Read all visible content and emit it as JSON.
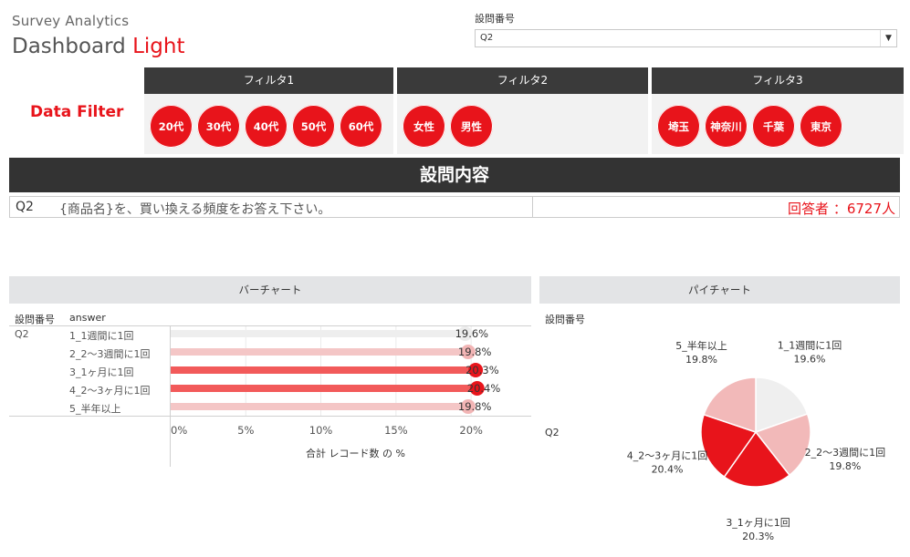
{
  "brand": {
    "subtitle": "Survey Analytics",
    "title_main": "Dashboard ",
    "title_accent": "Light"
  },
  "question_filter": {
    "label": "設問番号",
    "selected": "Q2"
  },
  "data_filter_title": "Data Filter",
  "filters": [
    {
      "header": "フィルタ1",
      "chips": [
        "20代",
        "30代",
        "40代",
        "50代",
        "60代"
      ]
    },
    {
      "header": "フィルタ2",
      "chips": [
        "女性",
        "男性"
      ]
    },
    {
      "header": "フィルタ3",
      "chips": [
        "埼玉",
        "神奈川",
        "千葉",
        "東京"
      ]
    }
  ],
  "section_header": "設問内容",
  "question": {
    "id": "Q2",
    "text": "{商品名}を、買い換える頻度をお答え下さい。",
    "respondents": "回答者 ：6727人"
  },
  "bar_panel": {
    "title": "バーチャート",
    "col_question": "設問番号",
    "col_answer": "answer",
    "question_id": "Q2"
  },
  "pie_panel": {
    "title": "パイチャート",
    "col_question": "設問番号",
    "question_id": "Q2"
  },
  "colors": {
    "accent": "#e8141b",
    "dark_header": "#333333"
  },
  "chart_data": [
    {
      "type": "bar",
      "orientation": "horizontal",
      "categories": [
        "1_1週間に1回",
        "2_2～3週間に1回",
        "3_1ヶ月に1回",
        "4_2～3ヶ月に1回",
        "5_半年以上"
      ],
      "values": [
        19.6,
        19.8,
        20.3,
        20.4,
        19.8
      ],
      "value_labels": [
        "19.6%",
        "19.8%",
        "20.3%",
        "20.4%",
        "19.8%"
      ],
      "colors": [
        "#eeeeee",
        "#f4c6c6",
        "#f25a5a",
        "#f25a5a",
        "#f4c6c6"
      ],
      "dot_colors": [
        "#ececec",
        "#f2b5b5",
        "#e8141b",
        "#e8141b",
        "#f2b5b5"
      ],
      "xlabel": "合計 レコード数 の %",
      "xticks": [
        "0%",
        "5%",
        "10%",
        "15%",
        "20%"
      ],
      "xlim": [
        0,
        24
      ],
      "grid": true
    },
    {
      "type": "pie",
      "categories": [
        "1_1週間に1回",
        "2_2～3週間に1回",
        "3_1ヶ月に1回",
        "4_2～3ヶ月に1回",
        "5_半年以上"
      ],
      "values": [
        19.6,
        19.8,
        20.3,
        20.4,
        19.8
      ],
      "value_labels": [
        "19.6%",
        "19.8%",
        "20.3%",
        "20.4%",
        "19.8%"
      ],
      "colors": [
        "#efefef",
        "#f2b9b9",
        "#e8141b",
        "#e8141b",
        "#f2b9b9"
      ]
    }
  ]
}
